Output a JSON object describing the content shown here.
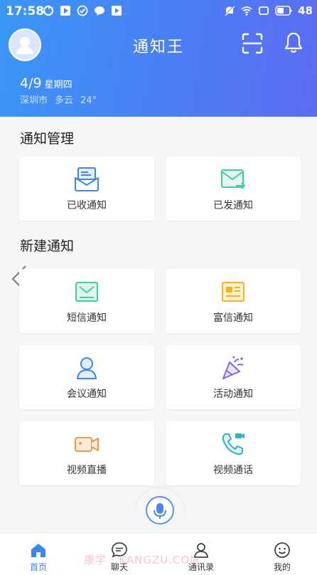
{
  "status_bar": {
    "time": "17:58",
    "battery": "48"
  },
  "header": {
    "title": "通知王",
    "date": "4/9",
    "weekday": "星期四",
    "weather": {
      "city": "深圳市",
      "condition": "多云",
      "temperature": "24°"
    }
  },
  "sections": {
    "manage_title": "通知管理",
    "create_title": "新建通知"
  },
  "cards": {
    "received": "已收通知",
    "sent": "已发通知",
    "sms": "短信通知",
    "rich": "富信通知",
    "meeting": "会议通知",
    "event": "活动通知",
    "live": "视频直播",
    "video_call": "视频通话"
  },
  "tabs": {
    "home": "首页",
    "chat": "聊天",
    "contacts": "通讯录",
    "mine": "我的"
  },
  "watermark": "康学 · KANGZU.COM",
  "colors": {
    "header_start": "#3a96f6",
    "header_end": "#5d6cf3",
    "accent_blue": "#3a86f3",
    "green": "#3fcf9f",
    "yellow": "#f2b51e",
    "purple": "#7b68ee",
    "orange": "#f29748",
    "teal": "#2bb3c8"
  }
}
